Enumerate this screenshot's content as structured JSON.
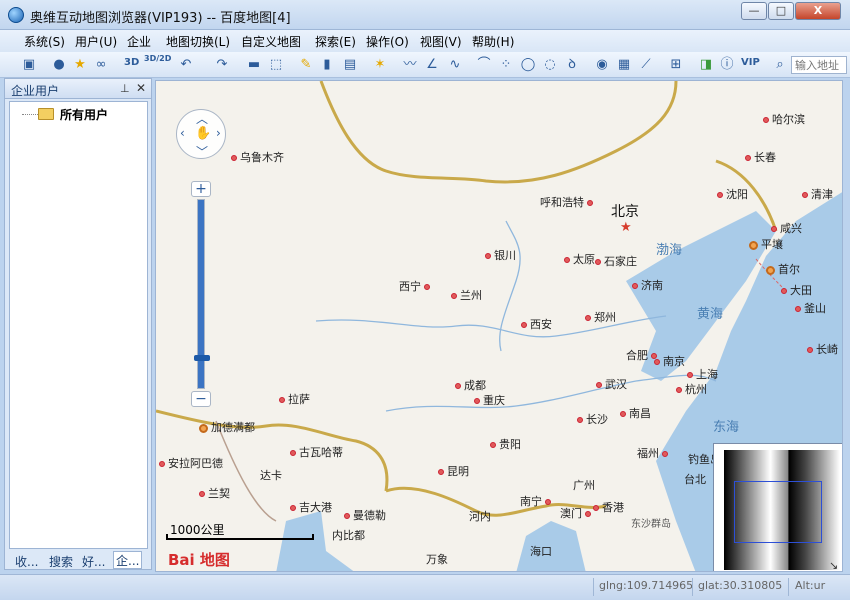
{
  "window": {
    "title": "奥维互动地图浏览器(VIP193) -- 百度地图[4]",
    "minimize": "—",
    "maximize": "□",
    "close": "X"
  },
  "menu": [
    "系统(S)",
    "用户(U)",
    "企业",
    "地图切换(L)",
    "自定义地图",
    "探索(E)",
    "操作(O)",
    "视图(V)",
    "帮助(H)"
  ],
  "toolbar": {
    "mode_3d": "3D",
    "mode_3d2d": "3D/2D",
    "vip": "VIP",
    "search_placeholder": "输入地址"
  },
  "side_panel": {
    "title": "企业用户",
    "pin": "⊥",
    "close": "✕",
    "tree_root": "所有用户",
    "tabs": [
      "收...",
      "搜索",
      "好...",
      "企..."
    ]
  },
  "map": {
    "cities": [
      "乌鲁木齐",
      "呼和浩特",
      "银川",
      "西宁",
      "兰州",
      "太原",
      "石家庄",
      "济南",
      "西安",
      "郑州",
      "合肥",
      "南京",
      "上海",
      "成都",
      "武汉",
      "杭州",
      "拉萨",
      "重庆",
      "长沙",
      "南昌",
      "贵阳",
      "福州",
      "昆明",
      "广州",
      "台北",
      "南宁",
      "澳门",
      "香港",
      "海口",
      "哈尔滨",
      "长春",
      "沈阳",
      "清津",
      "咸兴",
      "平壤",
      "首尔",
      "大田",
      "釜山",
      "长崎",
      "加德满都",
      "古瓦哈蒂",
      "安拉阿巴德",
      "兰契",
      "达卡",
      "吉大港",
      "曼德勒",
      "河内",
      "内比都",
      "万象",
      "钓鱼岛",
      "东沙群岛"
    ],
    "capital": "北京",
    "seas": [
      "渤海",
      "黄海",
      "东海"
    ],
    "scale": "1000公里",
    "logo": "Bai 地图"
  },
  "status": {
    "glng": "glng:109.714965",
    "glat": "glat:30.310805",
    "alt": "Alt:ur"
  }
}
